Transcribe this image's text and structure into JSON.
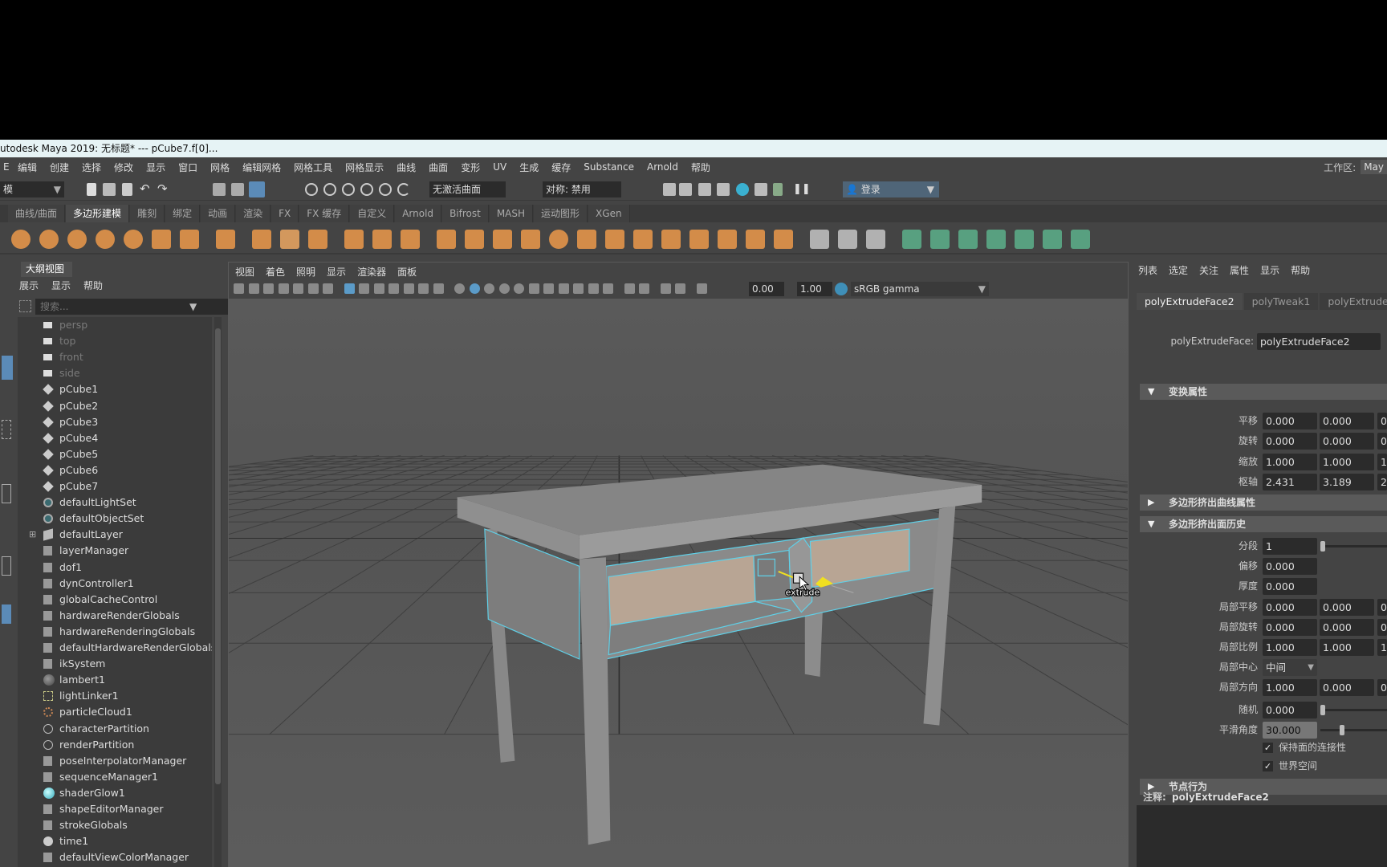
{
  "window": {
    "title": "utodesk Maya 2019: 无标题*   ---   pCube7.f[0]..."
  },
  "menubar": {
    "items": [
      "E",
      "编辑",
      "创建",
      "选择",
      "修改",
      "显示",
      "窗口",
      "网格",
      "编辑网格",
      "网格工具",
      "网格显示",
      "曲线",
      "曲面",
      "变形",
      "UV",
      "生成",
      "缓存",
      "Substance",
      "Arnold",
      "帮助"
    ],
    "workspace_label": "工作区:",
    "workspace_value": "May"
  },
  "statusbar": {
    "mode": "模",
    "no_live_surface": "无激活曲面",
    "symmetry": "对称: 禁用",
    "login": "登录"
  },
  "shelf": {
    "tabs": [
      "曲线/曲面",
      "多边形建模",
      "雕刻",
      "绑定",
      "动画",
      "渲染",
      "FX",
      "FX 缓存",
      "自定义",
      "Arnold",
      "Bifrost",
      "MASH",
      "运动图形",
      "XGen"
    ],
    "active_tab": "多边形建模",
    "icons": [
      "sphere",
      "cube",
      "cylinder",
      "cone",
      "torus",
      "plane",
      "disc",
      "platonic",
      "super-shape",
      "type",
      "svg",
      "mirror",
      "center-pivot",
      "freeze",
      "combine",
      "separate",
      "smooth",
      "boolean",
      "bevel",
      "bridge",
      "extrude",
      "append",
      "fill-hole",
      "multi-cut",
      "target-weld",
      "connect",
      "quad-draw",
      "edge-loop",
      "offset-loop",
      "planar-uv",
      "cylindrical-uv",
      "spherical-uv",
      "automatic-uv",
      "unfold",
      "layout",
      "uv-editor",
      "cut-sew"
    ],
    "colors": {
      "orange": "#e0924a",
      "teal": "#5aa886"
    }
  },
  "outliner": {
    "tab": "大纲视图",
    "menu": [
      "展示",
      "显示",
      "帮助"
    ],
    "search_placeholder": "搜索...",
    "items": [
      {
        "name": "persp",
        "icon": "camera"
      },
      {
        "name": "top",
        "icon": "camera"
      },
      {
        "name": "front",
        "icon": "camera"
      },
      {
        "name": "side",
        "icon": "camera"
      },
      {
        "name": "pCube1",
        "icon": "mesh"
      },
      {
        "name": "pCube2",
        "icon": "mesh"
      },
      {
        "name": "pCube3",
        "icon": "mesh"
      },
      {
        "name": "pCube4",
        "icon": "mesh"
      },
      {
        "name": "pCube5",
        "icon": "mesh"
      },
      {
        "name": "pCube6",
        "icon": "mesh"
      },
      {
        "name": "pCube7",
        "icon": "mesh"
      },
      {
        "name": "defaultLightSet",
        "icon": "set"
      },
      {
        "name": "defaultObjectSet",
        "icon": "set"
      },
      {
        "name": "defaultLayer",
        "icon": "layer",
        "expandable": true
      },
      {
        "name": "layerManager",
        "icon": "node"
      },
      {
        "name": "dof1",
        "icon": "node"
      },
      {
        "name": "dynController1",
        "icon": "node"
      },
      {
        "name": "globalCacheControl",
        "icon": "node"
      },
      {
        "name": "hardwareRenderGlobals",
        "icon": "node"
      },
      {
        "name": "hardwareRenderingGlobals",
        "icon": "node"
      },
      {
        "name": "defaultHardwareRenderGlobals",
        "icon": "node"
      },
      {
        "name": "ikSystem",
        "icon": "node"
      },
      {
        "name": "lambert1",
        "icon": "material"
      },
      {
        "name": "lightLinker1",
        "icon": "light-linker"
      },
      {
        "name": "particleCloud1",
        "icon": "particle"
      },
      {
        "name": "characterPartition",
        "icon": "partition"
      },
      {
        "name": "renderPartition",
        "icon": "partition"
      },
      {
        "name": "poseInterpolatorManager",
        "icon": "node"
      },
      {
        "name": "sequenceManager1",
        "icon": "node"
      },
      {
        "name": "shaderGlow1",
        "icon": "glow"
      },
      {
        "name": "shapeEditorManager",
        "icon": "node"
      },
      {
        "name": "strokeGlobals",
        "icon": "node"
      },
      {
        "name": "time1",
        "icon": "clock"
      },
      {
        "name": "defaultViewColorManager",
        "icon": "node"
      }
    ]
  },
  "viewport": {
    "menu": [
      "视图",
      "着色",
      "照明",
      "显示",
      "渲染器",
      "面板"
    ],
    "exposure": "0.00",
    "gamma": "1.00",
    "color_space": "sRGB gamma",
    "manipulator_label": "extrude",
    "colors": {
      "selection": "#5fd0e8",
      "manipulator": "#f0e020",
      "drawer_face": "#b8a594"
    }
  },
  "attr": {
    "menu": [
      "列表",
      "选定",
      "关注",
      "属性",
      "显示",
      "帮助"
    ],
    "tabs": [
      "polyExtrudeFace2",
      "polyTweak1",
      "polyExtrudeFac"
    ],
    "node_label": "polyExtrudeFace:",
    "node_value": "polyExtrudeFace2",
    "sec_transform": "变换属性",
    "transform_rows": [
      {
        "label": "平移",
        "values": [
          "0.000",
          "0.000",
          "0"
        ]
      },
      {
        "label": "旋转",
        "values": [
          "0.000",
          "0.000",
          "0"
        ]
      },
      {
        "label": "缩放",
        "values": [
          "1.000",
          "1.000",
          "1"
        ]
      },
      {
        "label": "枢轴",
        "values": [
          "2.431",
          "3.189",
          "2"
        ]
      }
    ],
    "sec_curve": "多边形挤出曲线属性",
    "sec_history": "多边形挤出面历史",
    "history_rows": [
      {
        "label": "分段",
        "values": [
          "1"
        ],
        "slider": 0.0
      },
      {
        "label": "偏移",
        "values": [
          "0.000"
        ]
      },
      {
        "label": "厚度",
        "values": [
          "0.000"
        ]
      },
      {
        "label": "局部平移",
        "values": [
          "0.000",
          "0.000",
          "0"
        ]
      },
      {
        "label": "局部旋转",
        "values": [
          "0.000",
          "0.000",
          "0"
        ]
      },
      {
        "label": "局部比例",
        "values": [
          "1.000",
          "1.000",
          "1"
        ]
      },
      {
        "label": "局部中心",
        "dropdown": "中间"
      },
      {
        "label": "局部方向",
        "values": [
          "1.000",
          "0.000",
          "0"
        ]
      },
      {
        "label": "随机",
        "values": [
          "0.000"
        ],
        "slider": 0.0
      },
      {
        "label": "平滑角度",
        "values": [
          "30.000"
        ],
        "slider": 0.17
      }
    ],
    "keep_faces_together": "保持面的连接性",
    "keep_faces_checked": true,
    "world_space": "世界空间",
    "world_space_checked": true,
    "sec_node": "节点行为",
    "notes_label": "注释:",
    "notes_value": "polyExtrudeFace2"
  }
}
